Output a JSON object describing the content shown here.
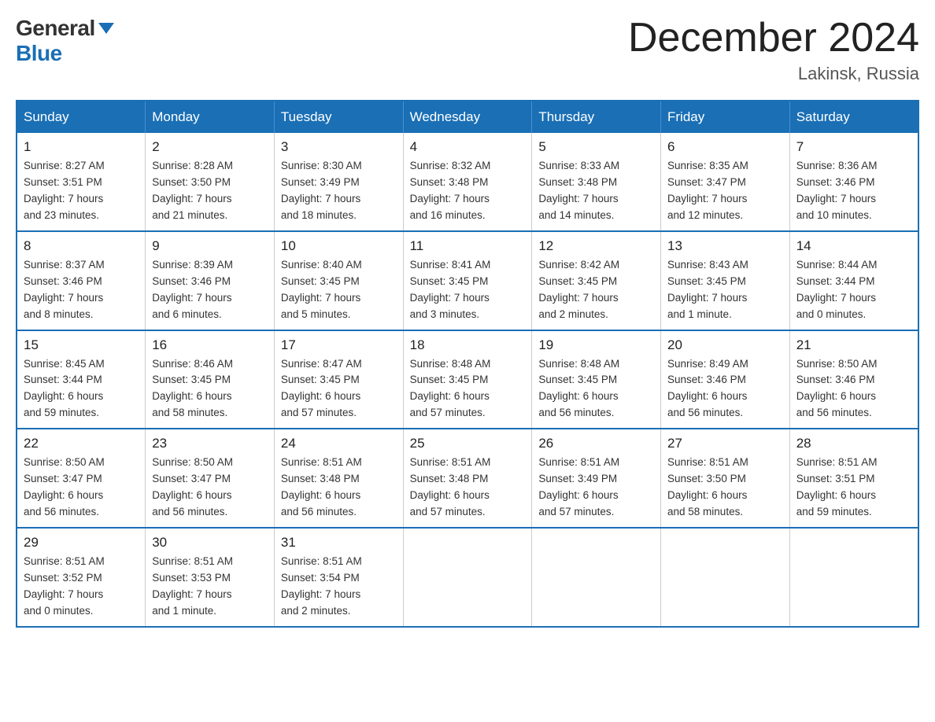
{
  "logo": {
    "general": "General",
    "blue": "Blue"
  },
  "title": "December 2024",
  "location": "Lakinsk, Russia",
  "days_of_week": [
    "Sunday",
    "Monday",
    "Tuesday",
    "Wednesday",
    "Thursday",
    "Friday",
    "Saturday"
  ],
  "weeks": [
    [
      {
        "day": "1",
        "info": "Sunrise: 8:27 AM\nSunset: 3:51 PM\nDaylight: 7 hours\nand 23 minutes."
      },
      {
        "day": "2",
        "info": "Sunrise: 8:28 AM\nSunset: 3:50 PM\nDaylight: 7 hours\nand 21 minutes."
      },
      {
        "day": "3",
        "info": "Sunrise: 8:30 AM\nSunset: 3:49 PM\nDaylight: 7 hours\nand 18 minutes."
      },
      {
        "day": "4",
        "info": "Sunrise: 8:32 AM\nSunset: 3:48 PM\nDaylight: 7 hours\nand 16 minutes."
      },
      {
        "day": "5",
        "info": "Sunrise: 8:33 AM\nSunset: 3:48 PM\nDaylight: 7 hours\nand 14 minutes."
      },
      {
        "day": "6",
        "info": "Sunrise: 8:35 AM\nSunset: 3:47 PM\nDaylight: 7 hours\nand 12 minutes."
      },
      {
        "day": "7",
        "info": "Sunrise: 8:36 AM\nSunset: 3:46 PM\nDaylight: 7 hours\nand 10 minutes."
      }
    ],
    [
      {
        "day": "8",
        "info": "Sunrise: 8:37 AM\nSunset: 3:46 PM\nDaylight: 7 hours\nand 8 minutes."
      },
      {
        "day": "9",
        "info": "Sunrise: 8:39 AM\nSunset: 3:46 PM\nDaylight: 7 hours\nand 6 minutes."
      },
      {
        "day": "10",
        "info": "Sunrise: 8:40 AM\nSunset: 3:45 PM\nDaylight: 7 hours\nand 5 minutes."
      },
      {
        "day": "11",
        "info": "Sunrise: 8:41 AM\nSunset: 3:45 PM\nDaylight: 7 hours\nand 3 minutes."
      },
      {
        "day": "12",
        "info": "Sunrise: 8:42 AM\nSunset: 3:45 PM\nDaylight: 7 hours\nand 2 minutes."
      },
      {
        "day": "13",
        "info": "Sunrise: 8:43 AM\nSunset: 3:45 PM\nDaylight: 7 hours\nand 1 minute."
      },
      {
        "day": "14",
        "info": "Sunrise: 8:44 AM\nSunset: 3:44 PM\nDaylight: 7 hours\nand 0 minutes."
      }
    ],
    [
      {
        "day": "15",
        "info": "Sunrise: 8:45 AM\nSunset: 3:44 PM\nDaylight: 6 hours\nand 59 minutes."
      },
      {
        "day": "16",
        "info": "Sunrise: 8:46 AM\nSunset: 3:45 PM\nDaylight: 6 hours\nand 58 minutes."
      },
      {
        "day": "17",
        "info": "Sunrise: 8:47 AM\nSunset: 3:45 PM\nDaylight: 6 hours\nand 57 minutes."
      },
      {
        "day": "18",
        "info": "Sunrise: 8:48 AM\nSunset: 3:45 PM\nDaylight: 6 hours\nand 57 minutes."
      },
      {
        "day": "19",
        "info": "Sunrise: 8:48 AM\nSunset: 3:45 PM\nDaylight: 6 hours\nand 56 minutes."
      },
      {
        "day": "20",
        "info": "Sunrise: 8:49 AM\nSunset: 3:46 PM\nDaylight: 6 hours\nand 56 minutes."
      },
      {
        "day": "21",
        "info": "Sunrise: 8:50 AM\nSunset: 3:46 PM\nDaylight: 6 hours\nand 56 minutes."
      }
    ],
    [
      {
        "day": "22",
        "info": "Sunrise: 8:50 AM\nSunset: 3:47 PM\nDaylight: 6 hours\nand 56 minutes."
      },
      {
        "day": "23",
        "info": "Sunrise: 8:50 AM\nSunset: 3:47 PM\nDaylight: 6 hours\nand 56 minutes."
      },
      {
        "day": "24",
        "info": "Sunrise: 8:51 AM\nSunset: 3:48 PM\nDaylight: 6 hours\nand 56 minutes."
      },
      {
        "day": "25",
        "info": "Sunrise: 8:51 AM\nSunset: 3:48 PM\nDaylight: 6 hours\nand 57 minutes."
      },
      {
        "day": "26",
        "info": "Sunrise: 8:51 AM\nSunset: 3:49 PM\nDaylight: 6 hours\nand 57 minutes."
      },
      {
        "day": "27",
        "info": "Sunrise: 8:51 AM\nSunset: 3:50 PM\nDaylight: 6 hours\nand 58 minutes."
      },
      {
        "day": "28",
        "info": "Sunrise: 8:51 AM\nSunset: 3:51 PM\nDaylight: 6 hours\nand 59 minutes."
      }
    ],
    [
      {
        "day": "29",
        "info": "Sunrise: 8:51 AM\nSunset: 3:52 PM\nDaylight: 7 hours\nand 0 minutes."
      },
      {
        "day": "30",
        "info": "Sunrise: 8:51 AM\nSunset: 3:53 PM\nDaylight: 7 hours\nand 1 minute."
      },
      {
        "day": "31",
        "info": "Sunrise: 8:51 AM\nSunset: 3:54 PM\nDaylight: 7 hours\nand 2 minutes."
      },
      {
        "day": "",
        "info": ""
      },
      {
        "day": "",
        "info": ""
      },
      {
        "day": "",
        "info": ""
      },
      {
        "day": "",
        "info": ""
      }
    ]
  ]
}
